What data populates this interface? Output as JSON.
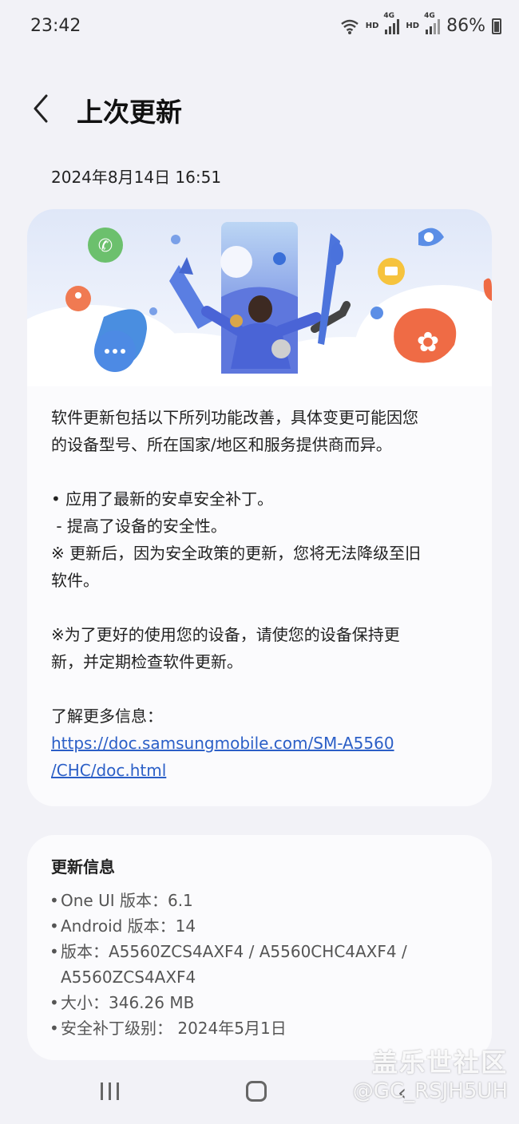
{
  "status_bar": {
    "time": "23:42",
    "hd1": "HD",
    "hd2": "HD",
    "net1": "4G",
    "net2": "4G",
    "battery": "86%"
  },
  "header": {
    "title": "上次更新",
    "back_icon": "chevron-left-icon"
  },
  "update_date": "2024年8月14日 16:51",
  "main_card": {
    "intro_line1": "软件更新包括以下所列功能改善，具体变更可能因您",
    "intro_line2": "的设备型号、所在国家/地区和服务提供商而异。",
    "item1": "• 应用了最新的安卓安全补丁。",
    "item1_sub": " - 提高了设备的安全性。",
    "note1_line1": "※ 更新后，因为安全政策的更新，您将无法降级至旧",
    "note1_line2": "软件。",
    "note2_line1": "※为了更好的使用您的设备，请使您的设备保持更",
    "note2_line2": "新，并定期检查软件更新。",
    "more_info_label": "了解更多信息：",
    "link_line1": "https://doc.samsungmobile.com/SM-A5560",
    "link_line2": "/CHC/doc.html"
  },
  "info_card": {
    "title": "更新信息",
    "one_ui": "One UI 版本：6.1",
    "android": "Android 版本：14",
    "build_line1": "版本：A5560ZCS4AXF4 / A5560CHC4AXF4 /",
    "build_line2": "A5560ZCS4AXF4",
    "size": "大小：346.26 MB",
    "security_patch": "安全补丁级别： 2024年5月1日"
  },
  "watermark": {
    "site": "盖乐世社区",
    "user": "@GC_RSJH5UH"
  },
  "colors": {
    "background": "#f2f2f7",
    "card": "#fbfbfd",
    "link": "#2b5fc7",
    "banner_blue": "#4f67d9"
  }
}
